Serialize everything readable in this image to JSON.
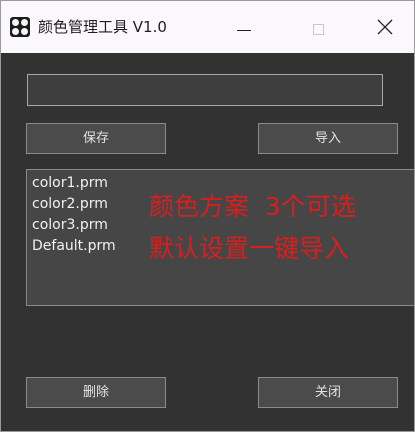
{
  "window": {
    "title": "颜色管理工具 V1.0",
    "buttons": {
      "minimize": "minimize-icon",
      "maximize": "maximize-icon",
      "close": "close-icon"
    }
  },
  "form": {
    "path_value": "",
    "save_label": "保存",
    "import_label": "导入",
    "delete_label": "删除",
    "close_label": "关闭"
  },
  "file_list": {
    "items": [
      "color1.prm",
      "color2.prm",
      "color3.prm",
      "Default.prm"
    ]
  },
  "annotation": {
    "line1": "颜色方案  3个可选",
    "line2": "默认设置一键导入",
    "color": "#d81f1f"
  },
  "colors": {
    "window_bg": "#323232",
    "titlebar_bg": "#fbf8fd",
    "button_bg": "#4b4b4b",
    "list_bg": "#464646"
  }
}
